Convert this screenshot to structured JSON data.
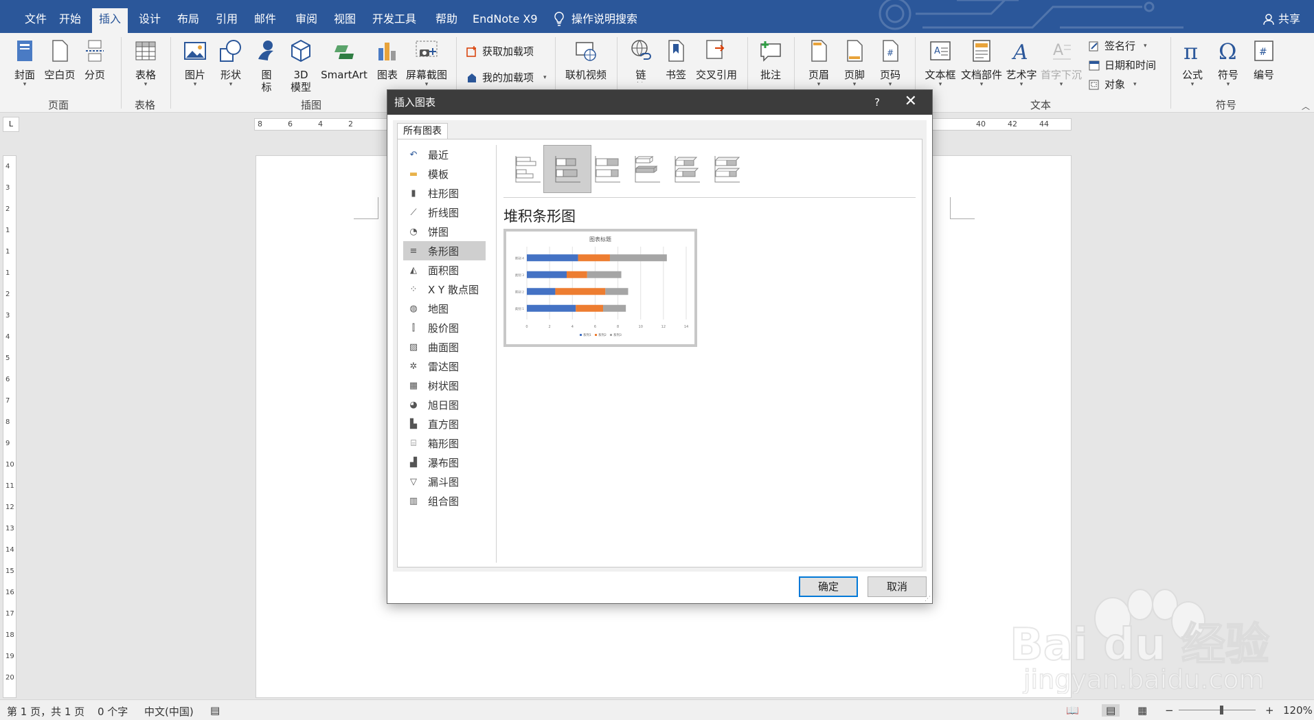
{
  "tabs": [
    {
      "label": "文件",
      "active": false
    },
    {
      "label": "开始",
      "active": false
    },
    {
      "label": "插入",
      "active": true
    },
    {
      "label": "设计",
      "active": false
    },
    {
      "label": "布局",
      "active": false
    },
    {
      "label": "引用",
      "active": false
    },
    {
      "label": "邮件",
      "active": false
    },
    {
      "label": "审阅",
      "active": false
    },
    {
      "label": "视图",
      "active": false
    },
    {
      "label": "开发工具",
      "active": false
    },
    {
      "label": "帮助",
      "active": false
    },
    {
      "label": "EndNote X9",
      "active": false
    }
  ],
  "tell_me": "操作说明搜索",
  "share": "共享",
  "ribbon": {
    "cover": "封面",
    "blank_page": "空白页",
    "page_break": "分页",
    "group_pages": "页面",
    "table": "表格",
    "group_table": "表格",
    "picture": "图片",
    "shapes": "形状",
    "icons": "图标",
    "model3d": "3D 模型",
    "smartart": "SmartArt",
    "chart": "图表",
    "screenshot": "屏幕截图",
    "group_illustrations": "插图",
    "get_addins": "获取加载项",
    "my_addins": "我的加载项",
    "online_video": "联机视频",
    "link": "链接",
    "bookmark": "书签",
    "cross_ref": "交叉引用",
    "comment": "批注",
    "header": "页眉",
    "footer": "页脚",
    "page_number": "页码",
    "textbox": "文本框",
    "quick_parts": "文档部件",
    "wordart": "艺术字",
    "drop_cap": "首字下沉",
    "signature_line": "签名行",
    "date_time": "日期和时间",
    "object": "对象",
    "group_text": "文本",
    "equation": "公式",
    "symbol": "符号",
    "number": "编号",
    "group_symbols": "符号"
  },
  "ruler": {
    "h_left": [
      "8",
      "6",
      "4",
      "2"
    ],
    "h_right": [
      "40",
      "42",
      "44"
    ],
    "v": [
      "4",
      "3",
      "2",
      "1",
      "1",
      "1",
      "2",
      "3",
      "4",
      "5",
      "6",
      "7",
      "8",
      "9",
      "10",
      "11",
      "12",
      "13",
      "14",
      "15",
      "16",
      "17",
      "18",
      "19",
      "20"
    ]
  },
  "status": {
    "page": "第 1 页，共 1 页",
    "words": "0 个字",
    "language": "中文(中国)",
    "zoom": "120%"
  },
  "dialog": {
    "title": "插入图表",
    "help": "?",
    "tab": "所有图表",
    "categories": [
      {
        "label": "最近",
        "icon": "recent-icon"
      },
      {
        "label": "模板",
        "icon": "folder-icon"
      },
      {
        "label": "柱形图",
        "icon": "column-chart-icon"
      },
      {
        "label": "折线图",
        "icon": "line-chart-icon"
      },
      {
        "label": "饼图",
        "icon": "pie-chart-icon"
      },
      {
        "label": "条形图",
        "icon": "bar-chart-icon",
        "selected": true
      },
      {
        "label": "面积图",
        "icon": "area-chart-icon"
      },
      {
        "label": "X Y 散点图",
        "icon": "scatter-chart-icon"
      },
      {
        "label": "地图",
        "icon": "map-chart-icon"
      },
      {
        "label": "股价图",
        "icon": "stock-chart-icon"
      },
      {
        "label": "曲面图",
        "icon": "surface-chart-icon"
      },
      {
        "label": "雷达图",
        "icon": "radar-chart-icon"
      },
      {
        "label": "树状图",
        "icon": "treemap-chart-icon"
      },
      {
        "label": "旭日图",
        "icon": "sunburst-chart-icon"
      },
      {
        "label": "直方图",
        "icon": "histogram-chart-icon"
      },
      {
        "label": "箱形图",
        "icon": "box-chart-icon"
      },
      {
        "label": "瀑布图",
        "icon": "waterfall-chart-icon"
      },
      {
        "label": "漏斗图",
        "icon": "funnel-chart-icon"
      },
      {
        "label": "组合图",
        "icon": "combo-chart-icon"
      }
    ],
    "selected_subtype": "堆积条形图",
    "ok": "确定",
    "cancel": "取消"
  },
  "chart_data": {
    "type": "bar",
    "stacked": true,
    "title": "图表标题",
    "categories": [
      "类别 1",
      "类别 2",
      "类别 3",
      "类别 4"
    ],
    "series": [
      {
        "name": "系列1",
        "color": "#4472c4",
        "values": [
          4.3,
          2.5,
          3.5,
          4.5
        ]
      },
      {
        "name": "系列2",
        "color": "#ed7d31",
        "values": [
          2.4,
          4.4,
          1.8,
          2.8
        ]
      },
      {
        "name": "系列3",
        "color": "#a5a5a5",
        "values": [
          2.0,
          2.0,
          3.0,
          5.0
        ]
      }
    ],
    "xlim": [
      0,
      14
    ],
    "xticks": [
      "0",
      "2",
      "4",
      "6",
      "8",
      "10",
      "12",
      "14"
    ],
    "legend": "bottom",
    "grid": true
  },
  "colors": {
    "accent": "#2b579a",
    "dialog_title": "#3c3c3c",
    "primary_button_border": "#0078d7"
  },
  "watermark": {
    "brand_text": "Bai du 经验",
    "url": "jingyan.baidu.com"
  }
}
